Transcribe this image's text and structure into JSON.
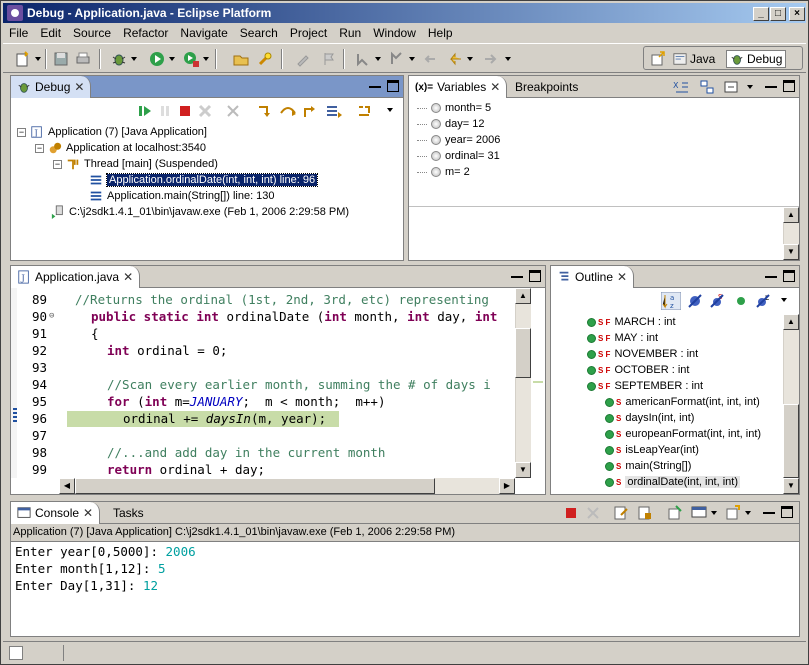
{
  "window": {
    "title": "Debug - Application.java - Eclipse Platform"
  },
  "menu": [
    "File",
    "Edit",
    "Source",
    "Refactor",
    "Navigate",
    "Search",
    "Project",
    "Run",
    "Window",
    "Help"
  ],
  "perspectives": {
    "java": "Java",
    "debug": "Debug"
  },
  "debug_view": {
    "tab": "Debug",
    "tree": [
      {
        "label": "Application (7) [Java Application]"
      },
      {
        "label": "Application at localhost:3540"
      },
      {
        "label": "Thread [main] (Suspended)"
      },
      {
        "label": "Application.ordinalDate(int, int, int) line: 96"
      },
      {
        "label": "Application.main(String[]) line: 130"
      },
      {
        "label": "C:\\j2sdk1.4.1_01\\bin\\javaw.exe (Feb 1, 2006 2:29:58 PM)"
      }
    ]
  },
  "variables_view": {
    "tabs": [
      "Variables",
      "Breakpoints"
    ],
    "vars": [
      "month= 5",
      "day= 12",
      "year= 2006",
      "ordinal= 31",
      "m= 2"
    ]
  },
  "editor": {
    "tab": "Application.java",
    "lines": [
      {
        "n": "89"
      },
      {
        "n": "90"
      },
      {
        "n": "91"
      },
      {
        "n": "92"
      },
      {
        "n": "93"
      },
      {
        "n": "94"
      },
      {
        "n": "95"
      },
      {
        "n": "96"
      },
      {
        "n": "97"
      },
      {
        "n": "98"
      },
      {
        "n": "99"
      }
    ],
    "code": {
      "l89": "//Returns the ordinal (1st, 2nd, 3rd, etc) representing",
      "l90_kw": "public static int",
      "l90_rest": " ordinalDate (",
      "l90_int1": "int",
      "l90_p1": " month, ",
      "l90_int2": "int",
      "l90_p2": " day, ",
      "l90_int3": "int",
      "l91": "{",
      "l92_kw": "int",
      "l92_rest": " ordinal = 0;",
      "l94": "//Scan every earlier month, summing the # of days i",
      "l95_kw": "for",
      "l95_a": " (",
      "l95_int": "int",
      "l95_b": " m=",
      "l95_const": "JANUARY",
      "l95_c": ";  m < month;  m++)",
      "l96_a": "ordinal += ",
      "l96_call": "daysIn",
      "l96_b": "(m, year);",
      "l98": "//...and add day in the current month",
      "l99_kw": "return",
      "l99_rest": " ordinal + day;"
    }
  },
  "outline": {
    "tab": "Outline",
    "items": [
      "MARCH : int",
      "MAY : int",
      "NOVEMBER : int",
      "OCTOBER : int",
      "SEPTEMBER : int",
      "americanFormat(int, int, int)",
      "daysIn(int, int)",
      "europeanFormat(int, int, int)",
      "isLeapYear(int)",
      "main(String[])",
      "ordinalDate(int, int, int)"
    ],
    "sf_marker": "S F",
    "s_marker": "S"
  },
  "console": {
    "tabs": [
      "Console",
      "Tasks"
    ],
    "process": "Application (7) [Java Application] C:\\j2sdk1.4.1_01\\bin\\javaw.exe (Feb 1, 2006 2:29:58 PM)",
    "lines": [
      {
        "prompt": "Enter year[0,5000]: ",
        "value": "2006"
      },
      {
        "prompt": "Enter month[1,12]: ",
        "value": "5"
      },
      {
        "prompt": "Enter Day[1,31]: ",
        "value": "12"
      }
    ]
  },
  "colors": {
    "title_start": "#0a246a",
    "title_end": "#a6caf0",
    "keyword": "#7f0055",
    "comment": "#3f7f5f",
    "current_line": "#c8dca8",
    "input": "#00a0a0"
  },
  "icons": [
    "debug-icon",
    "run-icon",
    "resume-icon",
    "suspend-icon",
    "terminate-icon",
    "step-into-icon",
    "step-over-icon",
    "step-return-icon"
  ]
}
